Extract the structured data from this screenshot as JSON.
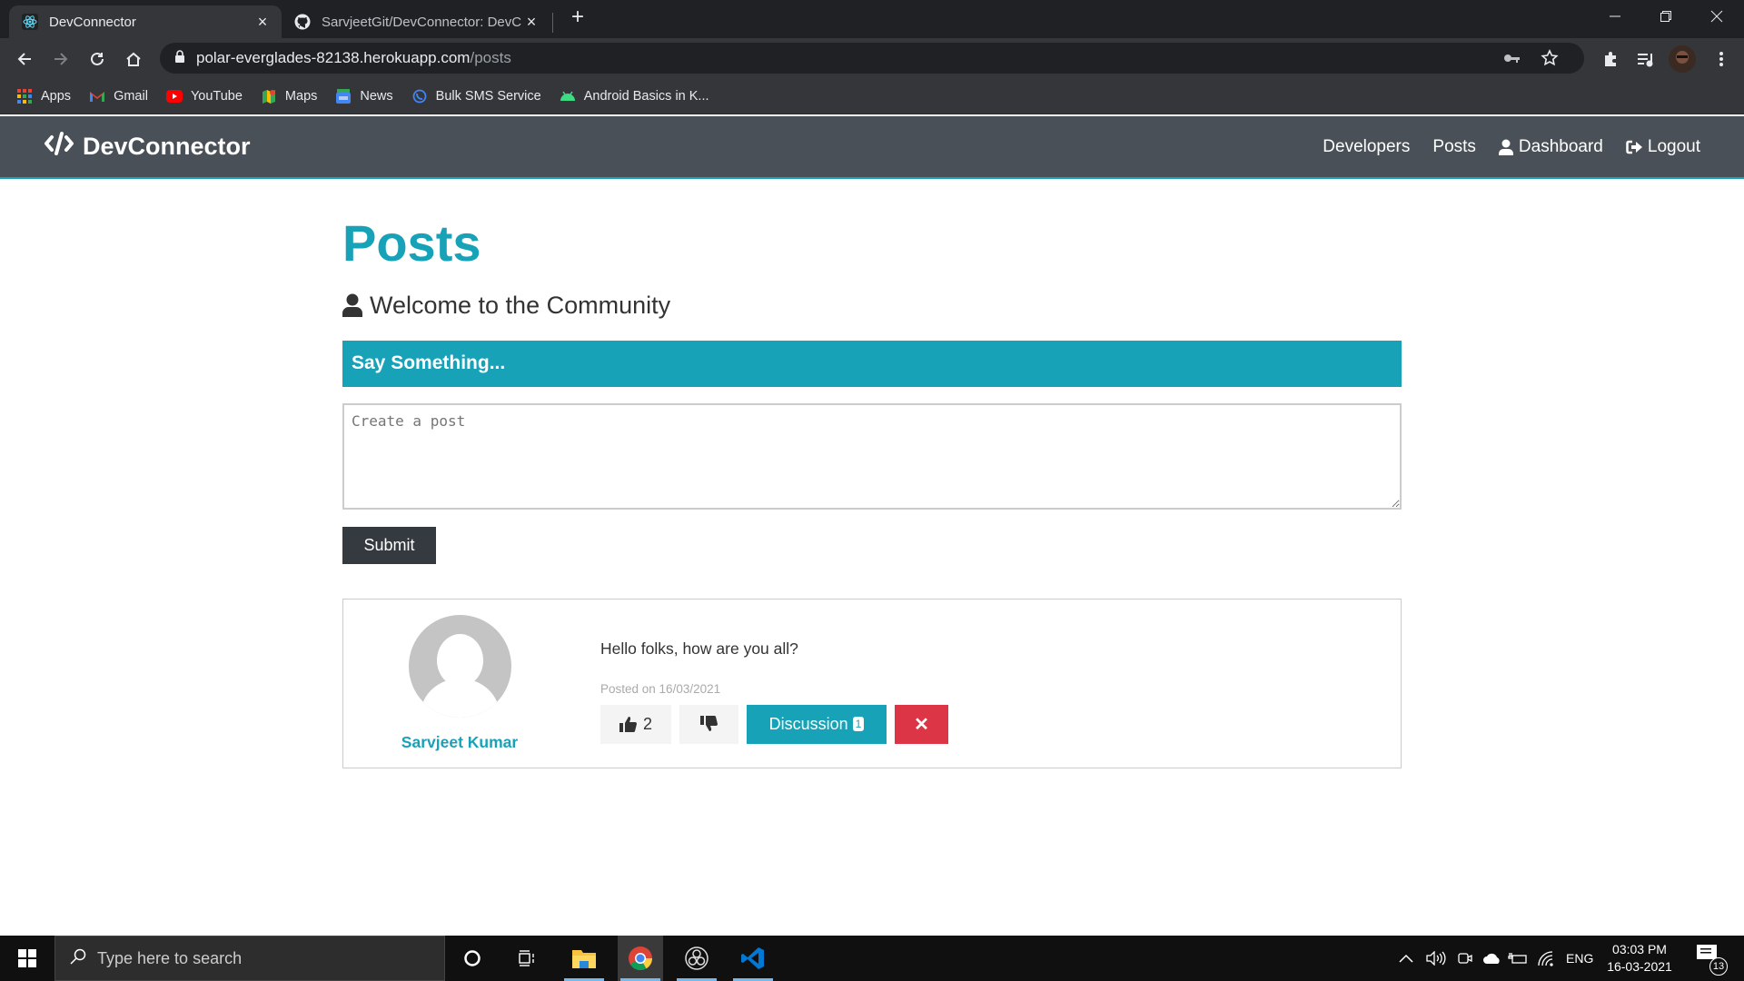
{
  "browser": {
    "tabs": [
      {
        "title": "DevConnector",
        "icon": "react-icon",
        "active": true
      },
      {
        "title": "SarvjeetGit/DevConnector: DevCo",
        "icon": "github-icon",
        "active": false
      }
    ],
    "url_host": "polar-everglades-82138.herokuapp.com",
    "url_path": "/posts",
    "bookmarks": [
      {
        "label": "Apps",
        "icon": "apps-grid-icon"
      },
      {
        "label": "Gmail",
        "icon": "gmail-icon"
      },
      {
        "label": "YouTube",
        "icon": "youtube-icon"
      },
      {
        "label": "Maps",
        "icon": "maps-icon"
      },
      {
        "label": "News",
        "icon": "news-icon"
      },
      {
        "label": "Bulk SMS Service",
        "icon": "sms-icon"
      },
      {
        "label": "Android Basics in K...",
        "icon": "android-icon"
      }
    ]
  },
  "app": {
    "brand": "DevConnector",
    "nav": {
      "developers": "Developers",
      "posts": "Posts",
      "dashboard": "Dashboard",
      "logout": "Logout"
    },
    "colors": {
      "primary": "#17a2b8",
      "dark": "#343a40",
      "danger": "#dc3545",
      "navbar": "#495057"
    }
  },
  "page": {
    "title": "Posts",
    "lead": "Welcome to the Community",
    "form": {
      "header": "Say Something...",
      "textarea_placeholder": "Create a post",
      "textarea_value": "",
      "submit_label": "Submit"
    },
    "posts": [
      {
        "author": "Sarvjeet Kumar",
        "text": "Hello folks, how are you all?",
        "date": "Posted on 16/03/2021",
        "likes": "2",
        "discussion_label": "Discussion",
        "comment_count": "1",
        "delete_label": "✕"
      }
    ]
  },
  "taskbar": {
    "search_placeholder": "Type here to search",
    "language": "ENG",
    "time": "03:03 PM",
    "date": "16-03-2021",
    "notification_count": "13"
  }
}
